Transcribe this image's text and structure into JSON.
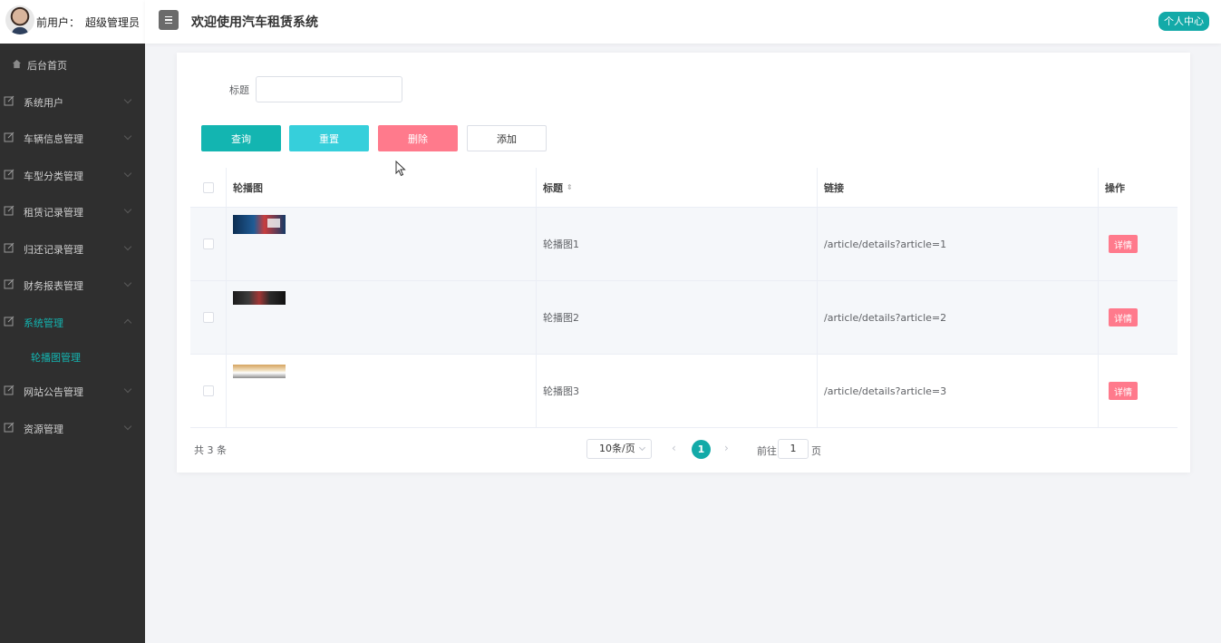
{
  "user": {
    "prefix": "前用户：",
    "name": "超级管理员"
  },
  "header": {
    "title": "欢迎使用汽车租赁系统",
    "personal_center": "个人中心"
  },
  "sidebar": {
    "home": "后台首页",
    "items": [
      {
        "label": "系统用户"
      },
      {
        "label": "车辆信息管理"
      },
      {
        "label": "车型分类管理"
      },
      {
        "label": "租赁记录管理"
      },
      {
        "label": "归还记录管理"
      },
      {
        "label": "财务报表管理"
      },
      {
        "label": "系统管理"
      },
      {
        "label": "网站公告管理"
      },
      {
        "label": "资源管理"
      }
    ],
    "active_sub": "轮播图管理"
  },
  "search": {
    "label": "标题",
    "value": ""
  },
  "buttons": {
    "query": "查询",
    "reset": "重置",
    "delete": "删除",
    "add": "添加"
  },
  "table": {
    "headers": {
      "image": "轮播图",
      "title": "标题",
      "link": "链接",
      "actions": "操作"
    },
    "rows": [
      {
        "title": "轮播图1",
        "link": "/article/details?article=1",
        "action": "详情"
      },
      {
        "title": "轮播图2",
        "link": "/article/details?article=2",
        "action": "详情"
      },
      {
        "title": "轮播图3",
        "link": "/article/details?article=3",
        "action": "详情"
      }
    ]
  },
  "pagination": {
    "total": "共 3 条",
    "page_size": "10条/页",
    "current_page": "1",
    "goto_label": "前往",
    "goto_value": "1",
    "goto_unit": "页"
  }
}
